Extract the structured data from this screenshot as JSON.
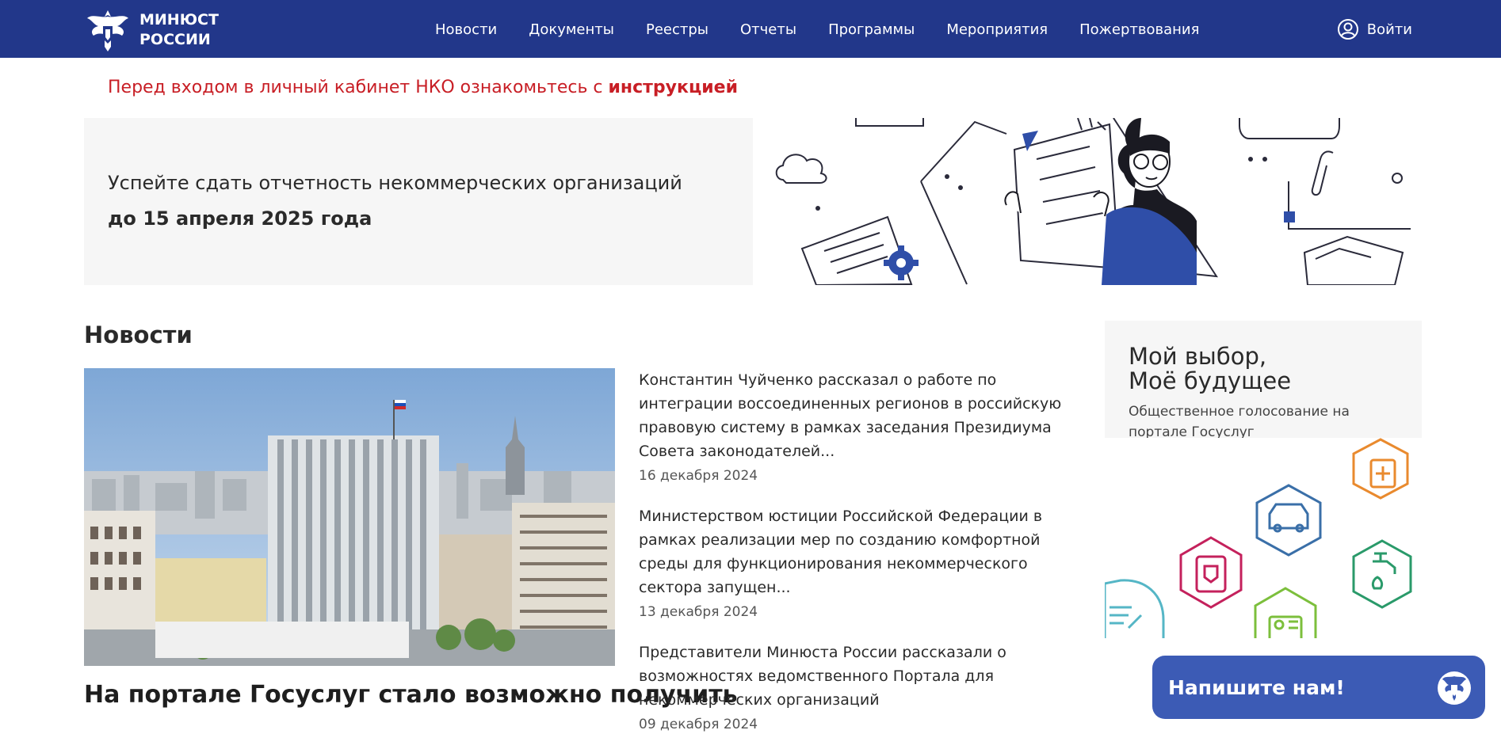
{
  "header": {
    "logo_line1": "МИНЮСТ",
    "logo_line2": "РОССИИ",
    "nav": [
      "Новости",
      "Документы",
      "Реестры",
      "Отчеты",
      "Программы",
      "Мероприятия",
      "Пожертвования"
    ],
    "login_label": "Войти"
  },
  "notice": {
    "text": "Перед входом в личный кабинет НКО ознакомьтесь с ",
    "link": "инструкцией"
  },
  "promo": {
    "line1": "Успейте сдать отчетность некоммерческих организаций",
    "line2": "до 15 апреля 2025 года"
  },
  "news": {
    "section_title": "Новости",
    "featured_headline": "На портале Госуслуг стало возможно получить",
    "items": [
      {
        "text": "Константин Чуйченко рассказал о работе по интеграции воссоединенных регионов в российскую правовую систему в рамках заседания Президиума Совета законодателей...",
        "date": "16 декабря 2024"
      },
      {
        "text": "Министерством юстиции Российской Федерации в рамках реализации мер по созданию комфортной среды для функционирования некоммерческого сектора запущен...",
        "date": "13 декабря 2024"
      },
      {
        "text": "Представители Минюста России рассказали о возможностях ведомственного Портала для некоммерческих организаций",
        "date": "09 декабря 2024"
      }
    ]
  },
  "side": {
    "title_line1": "Мой выбор,",
    "title_line2": "Моё будущее",
    "subtitle": "Общественное голосование на портале Госуслуг"
  },
  "chat": {
    "label": "Напишите нам!"
  },
  "colors": {
    "header_bg": "#22378a",
    "notice_red": "#c81e25",
    "chat_bg": "#3c5bb5"
  }
}
